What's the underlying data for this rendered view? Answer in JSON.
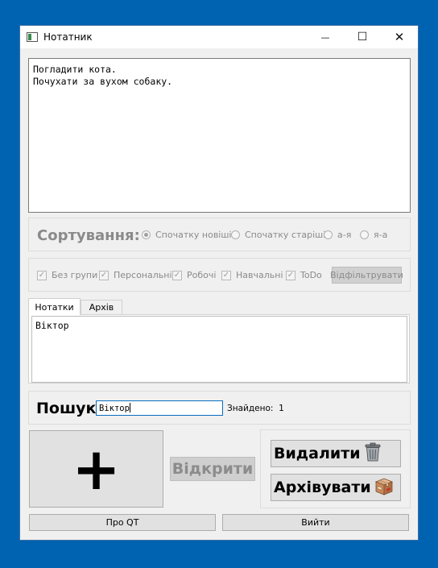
{
  "window": {
    "title": "Нотатник"
  },
  "titlebar": {
    "minimize_glyph": "—",
    "maximize_glyph": "☐",
    "close_glyph": "✕"
  },
  "notes_text": "Погладити кота.\nПочухати за вухом собаку.",
  "sort": {
    "label": "Сортування:",
    "options": [
      {
        "label": "Спочатку новіші",
        "checked": true
      },
      {
        "label": "Спочатку старіші",
        "checked": false
      },
      {
        "label": "а-я",
        "checked": false
      },
      {
        "label": "я-а",
        "checked": false
      }
    ]
  },
  "filters": {
    "items": [
      {
        "label": "Без групи",
        "checked": true
      },
      {
        "label": "Персональні",
        "checked": true
      },
      {
        "label": "Робочі",
        "checked": true
      },
      {
        "label": "Навчальні",
        "checked": true
      },
      {
        "label": "ToDo",
        "checked": true
      }
    ],
    "button_label": "Відфільтрувати"
  },
  "tabs": [
    {
      "label": "Нотатки",
      "active": true
    },
    {
      "label": "Архів",
      "active": false
    }
  ],
  "list_items": [
    "Віктор"
  ],
  "search": {
    "label": "Пошук",
    "value": "Віктор",
    "found_label": "Знайдено:",
    "found_count": "1"
  },
  "actions": {
    "add_glyph": "+",
    "open_label": "Відкрити",
    "delete_label": "Видалити",
    "archive_label": "Архівувати",
    "delete_icon": "trash-can-icon",
    "archive_icon": "cardboard-box-icon"
  },
  "bottom": {
    "about_label": "Про QT",
    "exit_label": "Вийти"
  },
  "colors": {
    "desktop": "#0063b1",
    "window_bg": "#f0f0f0",
    "disabled_text": "#8a8a8a",
    "focus_border": "#0a6ebd"
  }
}
